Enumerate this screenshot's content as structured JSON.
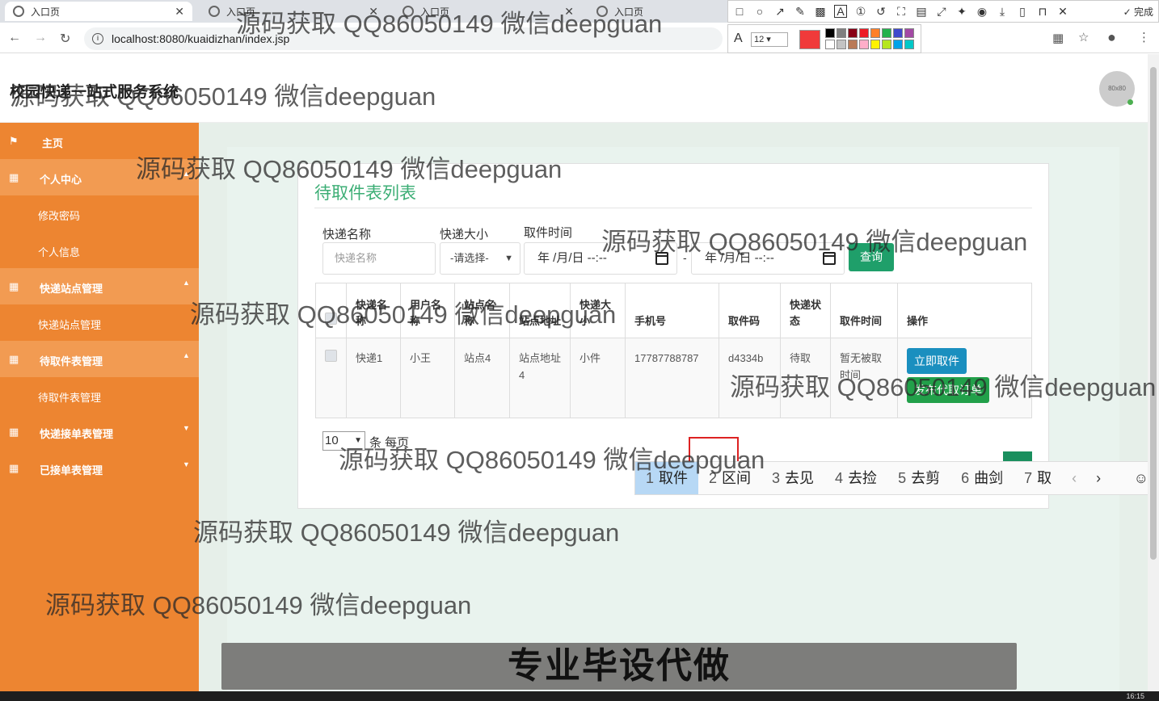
{
  "browser": {
    "tabs": [
      {
        "label": "入口页"
      },
      {
        "label": "入口页"
      },
      {
        "label": "入口页"
      },
      {
        "label": "入口页"
      }
    ],
    "url": "localhost:8080/kuaidizhan/index.jsp"
  },
  "annotation_toolbar": {
    "done_label": "完成",
    "font_size": "12",
    "current_color": "#f03a3a",
    "palette": [
      "#000000",
      "#7f7f7f",
      "#880015",
      "#ed1c24",
      "#ff7f27",
      "#22b14c",
      "#3f48cc",
      "#a349a4",
      "#ffffff",
      "#c3c3c3",
      "#b97a57",
      "#ffaec9",
      "#fff200",
      "#b5e61d",
      "#00a2e8",
      "#00c8c8"
    ]
  },
  "header": {
    "app_title": "校园快递一站式服务系统",
    "avatar_text": "80x80"
  },
  "sidebar": {
    "items": [
      {
        "label": "主页",
        "icon": "flag-icon"
      },
      {
        "label": "个人中心",
        "icon": "grid-icon"
      },
      {
        "label": "修改密码"
      },
      {
        "label": "个人信息"
      },
      {
        "label": "快递站点管理",
        "icon": "grid-icon"
      },
      {
        "label": "快递站点管理"
      },
      {
        "label": "待取件表管理",
        "icon": "grid-icon"
      },
      {
        "label": "待取件表管理"
      },
      {
        "label": "快递接单表管理",
        "icon": "grid-icon"
      },
      {
        "label": "已接单表管理",
        "icon": "grid-icon"
      }
    ]
  },
  "panel": {
    "title": "待取件表列表",
    "filters": {
      "name_label": "快递名称",
      "name_placeholder": "快递名称",
      "size_label": "快递大小",
      "size_value": "-请选择-",
      "time_label": "取件时间",
      "date_from": "年 /月/日 --:--",
      "date_to": "年 /月/日 --:--",
      "range_sep": "-",
      "query_button": "查询"
    },
    "table": {
      "headers": [
        "快递名称",
        "用户名称",
        "站点名称",
        "站点地址",
        "快递大小",
        "手机号",
        "取件码",
        "快递状态",
        "取件时间",
        "操作"
      ],
      "rows": [
        {
          "name": "快递1",
          "user": "小王",
          "station": "站点4",
          "address": "站点地址4",
          "size": "小件",
          "phone": "17787788787",
          "code": "d4334b",
          "status": "待取",
          "time": "暂无被取时间",
          "action_take": "立即取件",
          "action_publish": "发布代取订单"
        }
      ]
    },
    "pagination": {
      "page_size": "10",
      "per_page_label": "条 每页"
    }
  },
  "ime": {
    "candidates": [
      {
        "n": "1",
        "text": "取件"
      },
      {
        "n": "2",
        "text": "区间"
      },
      {
        "n": "3",
        "text": "去见"
      },
      {
        "n": "4",
        "text": "去捡"
      },
      {
        "n": "5",
        "text": "去剪"
      },
      {
        "n": "6",
        "text": "曲剑"
      },
      {
        "n": "7",
        "text": "取"
      }
    ]
  },
  "overlay": {
    "watermark": "源码获取 QQ86050149 微信deepguan",
    "banner": "专业毕设代做"
  },
  "taskbar": {
    "clock": "16:15"
  }
}
